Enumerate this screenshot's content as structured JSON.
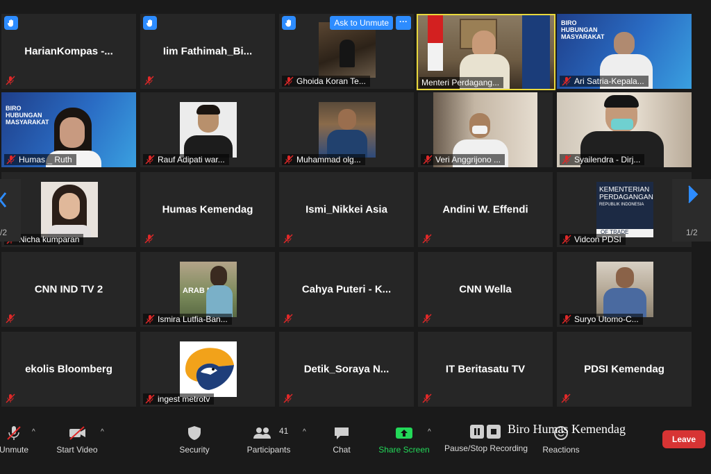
{
  "participants": [
    {
      "name": "HarianKompas  -...",
      "center": true,
      "hand": true
    },
    {
      "name": "Iim  Fathimah_Bi...",
      "center": true,
      "hand": true
    },
    {
      "name": "Ghoida Koran Te...",
      "hand": true
    },
    {
      "name": "Menteri Perdagang..."
    },
    {
      "name": "Ari Satria-Kepala..."
    },
    {
      "name": "Humas _ Ruth"
    },
    {
      "name": "Rauf Adipati war..."
    },
    {
      "name": "Muhammad olg..."
    },
    {
      "name": "Veri Anggrijono ..."
    },
    {
      "name": "Syailendra - Dirj..."
    },
    {
      "name": "Nicha kumparan"
    },
    {
      "name": "Humas Kemendag",
      "center": true
    },
    {
      "name": "Ismi_Nikkei Asia",
      "center": true
    },
    {
      "name": "Andini W. Effendi",
      "center": true
    },
    {
      "name": "Vidcon PDSI"
    },
    {
      "name": "CNN IND TV 2",
      "center": true
    },
    {
      "name": "Ismira Lutfia-Ban..."
    },
    {
      "name": "Cahya Puteri - K...",
      "center": true
    },
    {
      "name": "CNN Wella",
      "center": true
    },
    {
      "name": "Suryo Utomo-C..."
    },
    {
      "name": "ekolis Bloomberg",
      "center": true
    },
    {
      "name": "ingest metrotv"
    },
    {
      "name": "Detik_Soraya  N...",
      "center": true
    },
    {
      "name": "IT Beritasatu TV",
      "center": true
    },
    {
      "name": "PDSI Kemendag",
      "center": true
    }
  ],
  "tile_overlays": {
    "ask_to_unmute": "Ask to Unmute",
    "more": "···"
  },
  "banner_text": {
    "biro_line1": "BIRO",
    "biro_line2": "HUBUNGAN",
    "biro_line3": "MASYARAKAT",
    "kementerian": "KEMENTERIAN",
    "perdagangan": "PERDAGANGAN",
    "republik": "REPUBLIK INDONESIA",
    "of_trade": "OF TRADE",
    "arab_news": "ARAB NEWS"
  },
  "pagination": {
    "left": "/2",
    "right": "1/2"
  },
  "toolbar": {
    "unmute": "Unmute",
    "start_video": "Start Video",
    "security": "Security",
    "participants": "Participants",
    "participants_count": "41",
    "chat": "Chat",
    "share_screen": "Share Screen",
    "record": "Pause/Stop Recording",
    "reactions": "Reactions",
    "leave": "Leave"
  },
  "watermark": "Biro Humas Kemendag",
  "colors": {
    "accent": "#2d8cff",
    "share": "#23d959",
    "leave": "#d73434",
    "mute": "#e02828",
    "active_speaker": "#e9d93c"
  }
}
